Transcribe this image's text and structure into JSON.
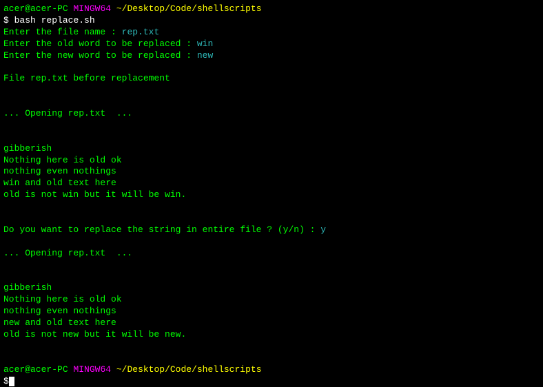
{
  "prompt1": {
    "user_host": "acer@acer-PC",
    "shell": "MINGW64",
    "path": "~/Desktop/Code/shellscripts",
    "symbol": "$"
  },
  "command": "bash replace.sh",
  "interact": {
    "filename_prompt": "Enter the file name : ",
    "filename_input": "rep.txt",
    "oldword_prompt": "Enter the old word to be replaced : ",
    "oldword_input": "win",
    "newword_prompt": "Enter the new word to be replaced : ",
    "newword_input": "new"
  },
  "before_header": "File rep.txt before replacement",
  "opening1": "... Opening rep.txt  ...",
  "file_before": [
    "gibberish",
    "Nothing here is old ok",
    "nothing even nothings",
    "win and old text here",
    "old is not win but it will be win."
  ],
  "confirm": {
    "prompt": "Do you want to replace the string in entire file ? (y/n) : ",
    "input": "y"
  },
  "opening2": "... Opening rep.txt  ...",
  "file_after": [
    "gibberish",
    "Nothing here is old ok",
    "nothing even nothings",
    "new and old text here",
    "old is not new but it will be new."
  ],
  "prompt2": {
    "user_host": "acer@acer-PC",
    "shell": "MINGW64",
    "path": "~/Desktop/Code/shellscripts",
    "symbol": "$"
  }
}
